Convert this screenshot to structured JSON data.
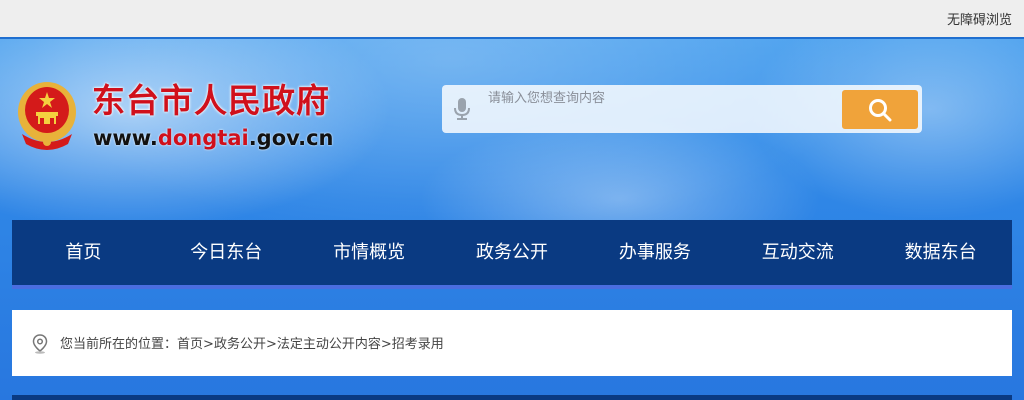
{
  "topbar": {
    "accessibility_label": "无障碍浏览"
  },
  "header": {
    "site_title": "东台市人民政府",
    "site_url_prefix": "www.",
    "site_url_highlight": "dongtai",
    "site_url_suffix": ".gov.cn"
  },
  "search": {
    "placeholder": "请输入您想查询内容",
    "value": ""
  },
  "nav": {
    "items": [
      {
        "label": "首页"
      },
      {
        "label": "今日东台"
      },
      {
        "label": "市情概览"
      },
      {
        "label": "政务公开"
      },
      {
        "label": "办事服务"
      },
      {
        "label": "互动交流"
      },
      {
        "label": "数据东台"
      }
    ]
  },
  "breadcrumb": {
    "prefix": "您当前所在的位置：",
    "items": [
      "首页",
      "政务公开",
      "法定主动公开内容",
      "招考录用"
    ],
    "separator": ">"
  },
  "colors": {
    "brand_red": "#d0101b",
    "nav_bg": "#0a3a82",
    "search_button": "#f0a33a",
    "topbar_bg": "#eeeeee"
  },
  "icons": {
    "emblem": "national-emblem-icon",
    "mic": "microphone-icon",
    "search": "search-icon",
    "location": "location-pin-icon"
  }
}
